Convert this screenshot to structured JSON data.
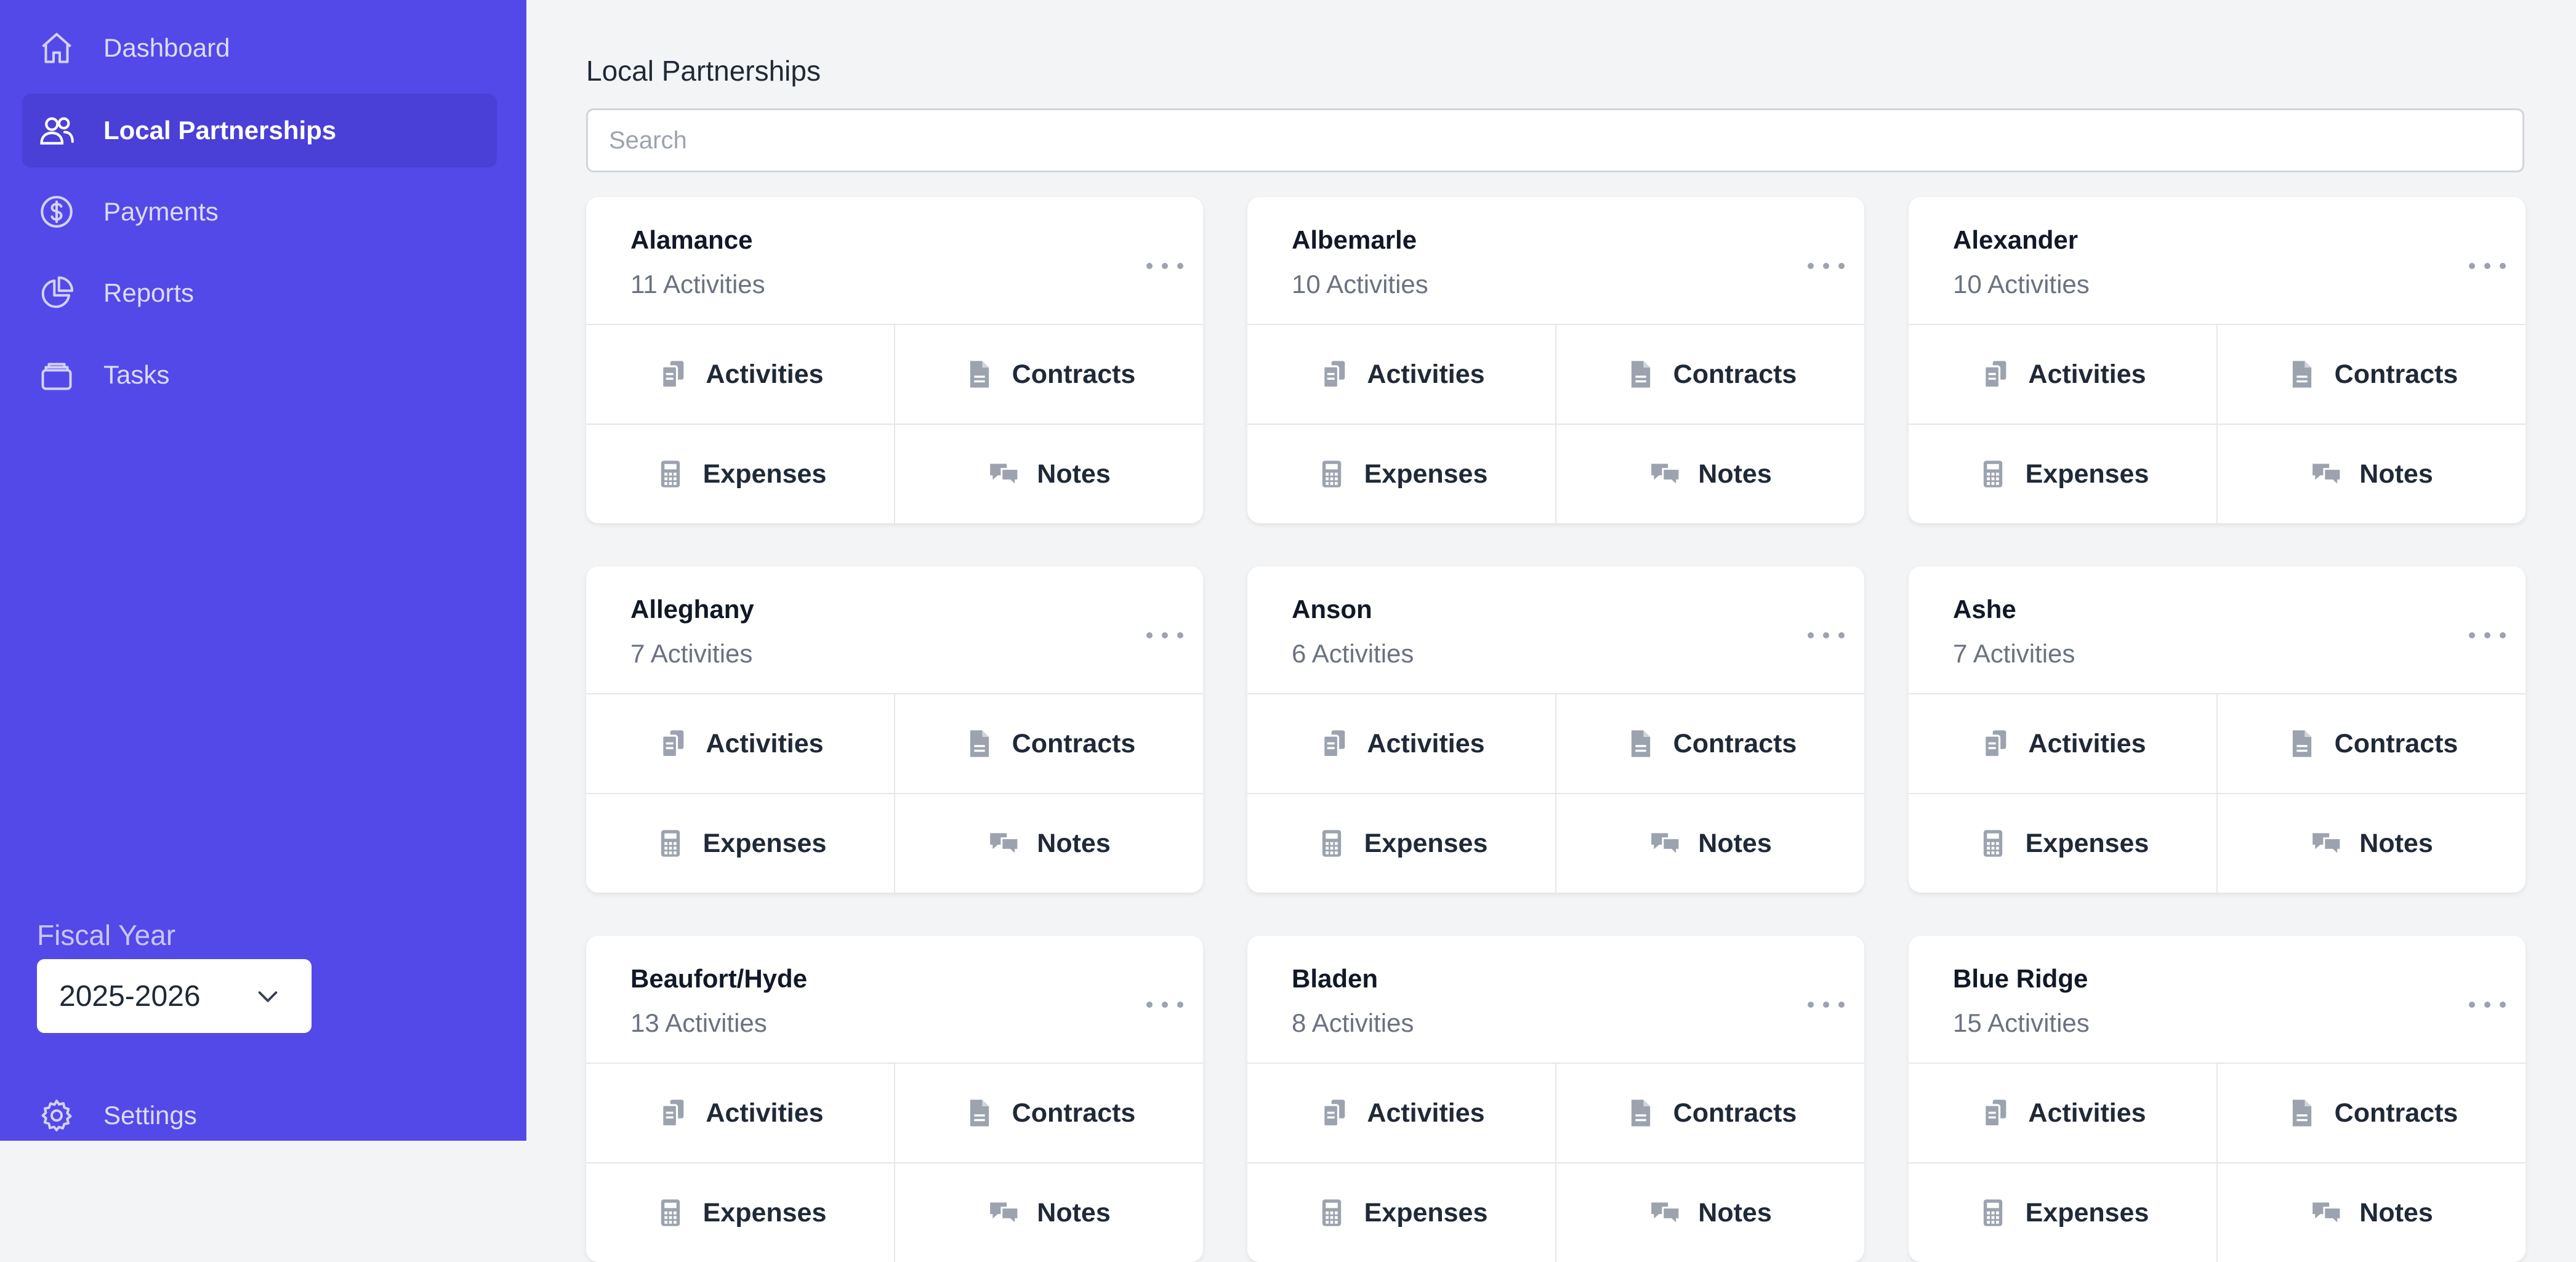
{
  "sidebar": {
    "nav": [
      {
        "label": "Dashboard",
        "icon": "home-icon"
      },
      {
        "label": "Local Partnerships",
        "icon": "users-icon",
        "active": true
      },
      {
        "label": "Payments",
        "icon": "dollar-circle-icon"
      },
      {
        "label": "Reports",
        "icon": "pie-chart-icon"
      },
      {
        "label": "Tasks",
        "icon": "tray-icon"
      }
    ],
    "fiscal_year_label": "Fiscal Year",
    "fiscal_year_value": "2025-2026",
    "settings_label": "Settings"
  },
  "main": {
    "title": "Local Partnerships",
    "search_placeholder": "Search",
    "card_actions": {
      "activities": "Activities",
      "contracts": "Contracts",
      "expenses": "Expenses",
      "notes": "Notes"
    },
    "partnerships": [
      {
        "name": "Alamance",
        "count": "11 Activities"
      },
      {
        "name": "Albemarle",
        "count": "10 Activities"
      },
      {
        "name": "Alexander",
        "count": "10 Activities"
      },
      {
        "name": "Alleghany",
        "count": "7 Activities"
      },
      {
        "name": "Anson",
        "count": "6 Activities"
      },
      {
        "name": "Ashe",
        "count": "7 Activities"
      },
      {
        "name": "Beaufort/Hyde",
        "count": "13 Activities"
      },
      {
        "name": "Bladen",
        "count": "8 Activities"
      },
      {
        "name": "Blue Ridge",
        "count": "15 Activities"
      }
    ]
  },
  "colors": {
    "sidebar_bg": "#5349e8",
    "sidebar_active": "#4a3fd6",
    "page_bg": "#f3f4f6",
    "icon_gray": "#9ca3af"
  }
}
